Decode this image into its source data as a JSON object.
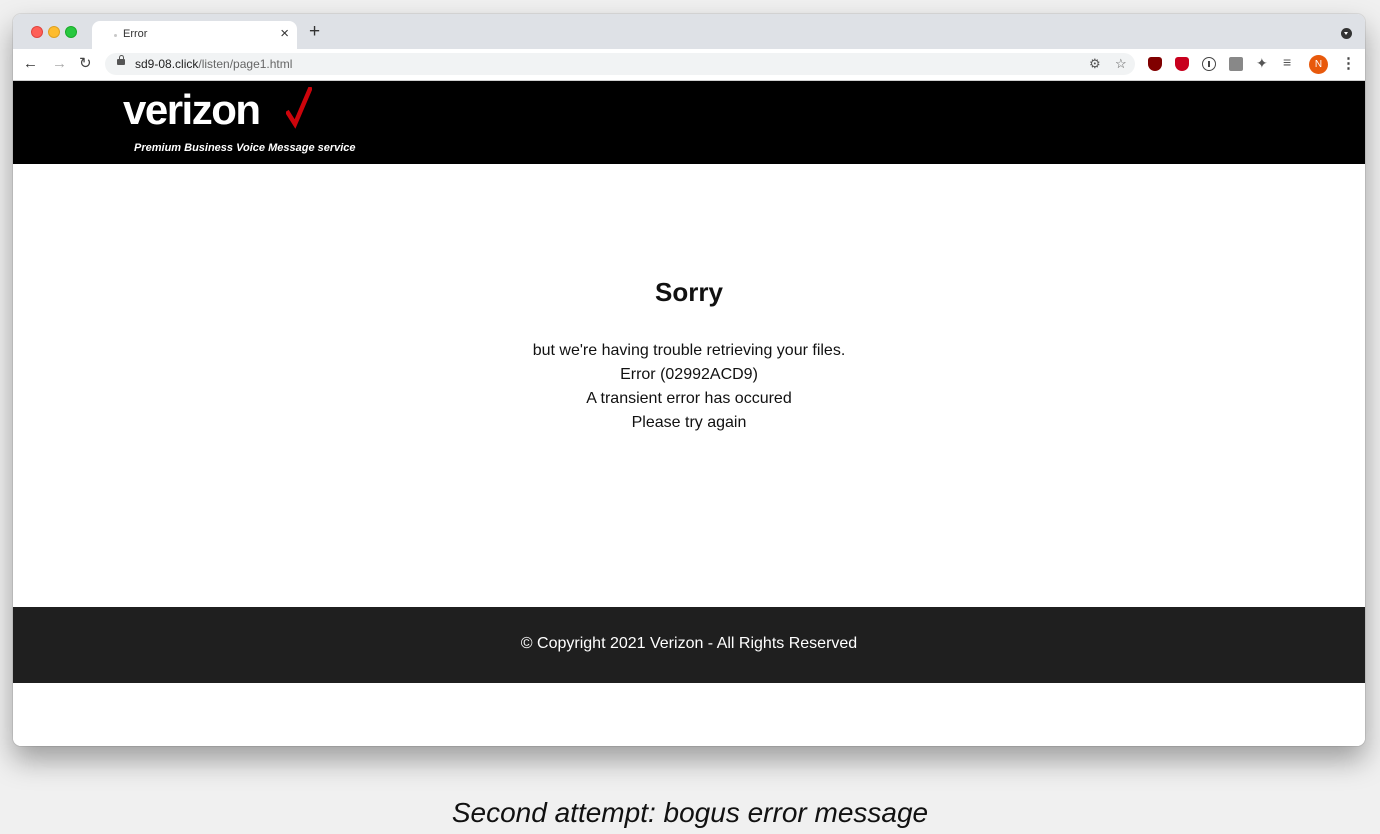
{
  "browser": {
    "tab_title": "Error",
    "tab_close_glyph": "×",
    "new_tab_glyph": "+",
    "url_host": "sd9-08.click",
    "url_path": "/listen/page1.html",
    "profile_initial": "N",
    "icons": [
      "back-icon",
      "forward-icon",
      "reload-icon",
      "lock-icon",
      "key-icon",
      "star-icon",
      "ublock-icon",
      "shield-icon",
      "onepassword-icon",
      "extension-box-icon",
      "puzzle-icon",
      "media-queue-icon",
      "menu-icon"
    ]
  },
  "site": {
    "logo_text": "verizon",
    "tagline": "Premium Business Voice Message service",
    "heading": "Sorry",
    "message_lines": [
      "but we're having trouble retrieving your files.",
      "Error (02992ACD9)",
      "A transient error has occured",
      "Please try again"
    ],
    "copyright": "© Copyright 2021 Verizon - All Rights Reserved"
  },
  "caption": "Second attempt: bogus error message",
  "colors": {
    "header_bg": "#000000",
    "footer_bg": "#1f1f1f",
    "logo_check": "#cd040b",
    "avatar_bg": "#e8590c"
  }
}
